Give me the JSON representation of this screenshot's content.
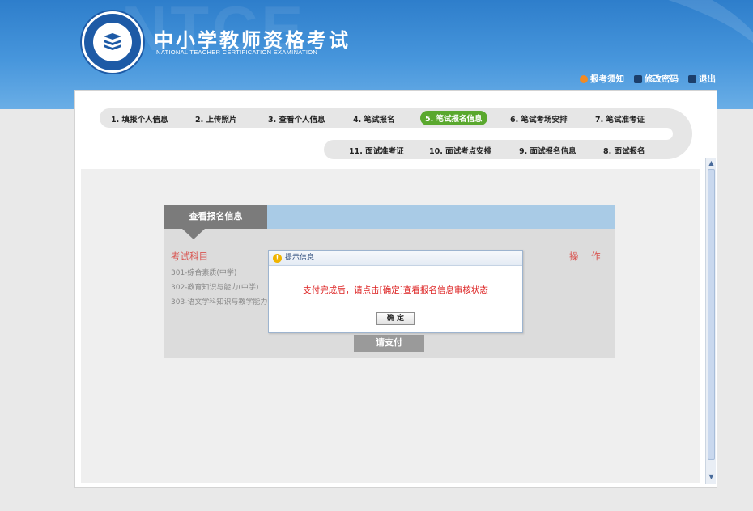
{
  "header": {
    "title_cn": "中小学教师资格考试",
    "title_en": "NATIONAL TEACHER CERTIFICATION EXAMINATION",
    "watermark": "NTCE",
    "links": [
      {
        "label": "报考须知",
        "icon": "info-icon",
        "color": "#f08a24"
      },
      {
        "label": "修改密码",
        "icon": "key-icon",
        "color": "#1c3f6b"
      },
      {
        "label": "退出",
        "icon": "logout-icon",
        "color": "#1c3f6b"
      }
    ]
  },
  "steps": {
    "row1": [
      "1. 填报个人信息",
      "2. 上传照片",
      "3. 查看个人信息",
      "4. 笔试报名",
      "5. 笔试报名信息",
      "6. 笔试考场安排",
      "7. 笔试准考证"
    ],
    "row2": [
      "11. 面试准考证",
      "10. 面试考点安排",
      "9. 面试报名信息",
      "8. 面试报名"
    ],
    "active_color": "#5aa82e"
  },
  "info": {
    "tab_label": "查看报名信息",
    "col_subject": "考试科目",
    "col_op": "操 作",
    "subjects": [
      "301-综合素质(中学)",
      "302-教育知识与能力(中学)",
      "303-语文学科知识与教学能力"
    ],
    "pay_button": "请支付"
  },
  "dialog": {
    "title": "提示信息",
    "message": "支付完成后，请点击[确定]查看报名信息审核状态",
    "ok_button": "确 定"
  }
}
